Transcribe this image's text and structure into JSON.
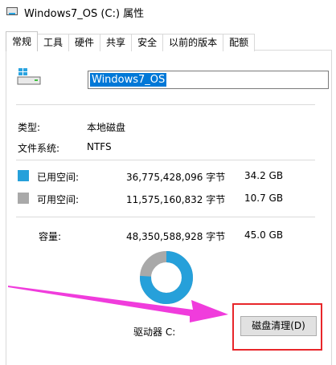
{
  "window": {
    "title": "Windows7_OS (C:) 属性"
  },
  "tabs": [
    {
      "label": "常规",
      "active": true
    },
    {
      "label": "工具"
    },
    {
      "label": "硬件"
    },
    {
      "label": "共享"
    },
    {
      "label": "安全"
    },
    {
      "label": "以前的版本"
    },
    {
      "label": "配额"
    }
  ],
  "general": {
    "drive_name": "Windows7_OS",
    "type_label": "类型:",
    "type_value": "本地磁盘",
    "fs_label": "文件系统:",
    "fs_value": "NTFS",
    "used": {
      "label": "已用空间:",
      "bytes": "36,775,428,096 字节",
      "size": "34.2 GB",
      "color": "#26a0da"
    },
    "free": {
      "label": "可用空间:",
      "bytes": "11,575,160,832 字节",
      "size": "10.7 GB",
      "color": "#a9a9a9"
    },
    "capacity": {
      "label": "容量:",
      "bytes": "48,350,588,928 字节",
      "size": "45.0 GB"
    },
    "drive_letter": "驱动器 C:",
    "cleanup_button": "磁盘清理(D)",
    "used_fraction": 0.76
  },
  "annotation": {
    "arrow_color": "#f03cdc",
    "box_color": "#e8262a"
  }
}
